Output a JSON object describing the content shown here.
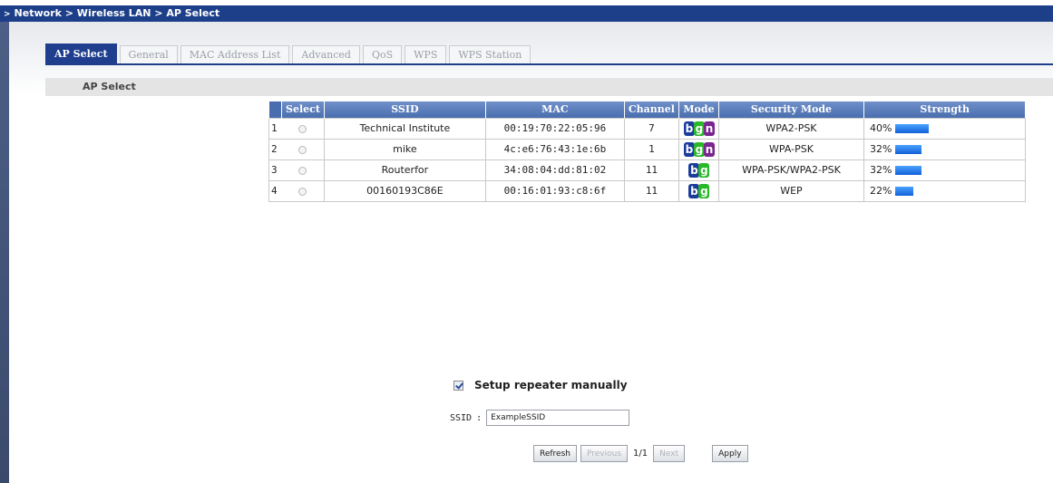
{
  "breadcrumb": "Network > Wireless LAN > AP Select",
  "tabs": [
    {
      "label": "AP Select",
      "active": true
    },
    {
      "label": "General",
      "active": false
    },
    {
      "label": "MAC Address List",
      "active": false
    },
    {
      "label": "Advanced",
      "active": false
    },
    {
      "label": "QoS",
      "active": false
    },
    {
      "label": "WPS",
      "active": false
    },
    {
      "label": "WPS Station",
      "active": false
    }
  ],
  "section_title": "AP Select",
  "table": {
    "headers": {
      "select": "Select",
      "ssid": "SSID",
      "mac": "MAC",
      "channel": "Channel",
      "mode": "Mode",
      "security": "Security Mode",
      "strength": "Strength"
    },
    "rows": [
      {
        "index": "1",
        "ssid": "Technical Institute",
        "mac": "00:19:70:22:05:96",
        "channel": "7",
        "mode": [
          "b",
          "g",
          "n"
        ],
        "security": "WPA2-PSK",
        "strength": "40%",
        "strength_value": 40
      },
      {
        "index": "2",
        "ssid": "mike",
        "mac": "4c:e6:76:43:1e:6b",
        "channel": "1",
        "mode": [
          "b",
          "g",
          "n"
        ],
        "security": "WPA-PSK",
        "strength": "32%",
        "strength_value": 32
      },
      {
        "index": "3",
        "ssid": "Routerfor",
        "mac": "34:08:04:dd:81:02",
        "channel": "11",
        "mode": [
          "b",
          "g"
        ],
        "security": "WPA-PSK/WPA2-PSK",
        "strength": "32%",
        "strength_value": 32
      },
      {
        "index": "4",
        "ssid": "00160193C86E",
        "mac": "00:16:01:93:c8:6f",
        "channel": "11",
        "mode": [
          "b",
          "g"
        ],
        "security": "WEP",
        "strength": "22%",
        "strength_value": 22
      }
    ]
  },
  "repeater": {
    "label": "Setup repeater manually",
    "checked": true
  },
  "ssid_field": {
    "label": "SSID",
    "separator": ":",
    "value": "ExampleSSID"
  },
  "buttons": {
    "refresh": "Refresh",
    "previous": "Previous",
    "page": "1/1",
    "next": "Next",
    "apply": "Apply"
  },
  "colors": {
    "nav_blue": "#1d3f8a",
    "header_blue": "#4a6daf",
    "mode_b": "#1c3c9c",
    "mode_g": "#28b828",
    "mode_n": "#7a2590",
    "strength_bar": "#1461d8"
  }
}
